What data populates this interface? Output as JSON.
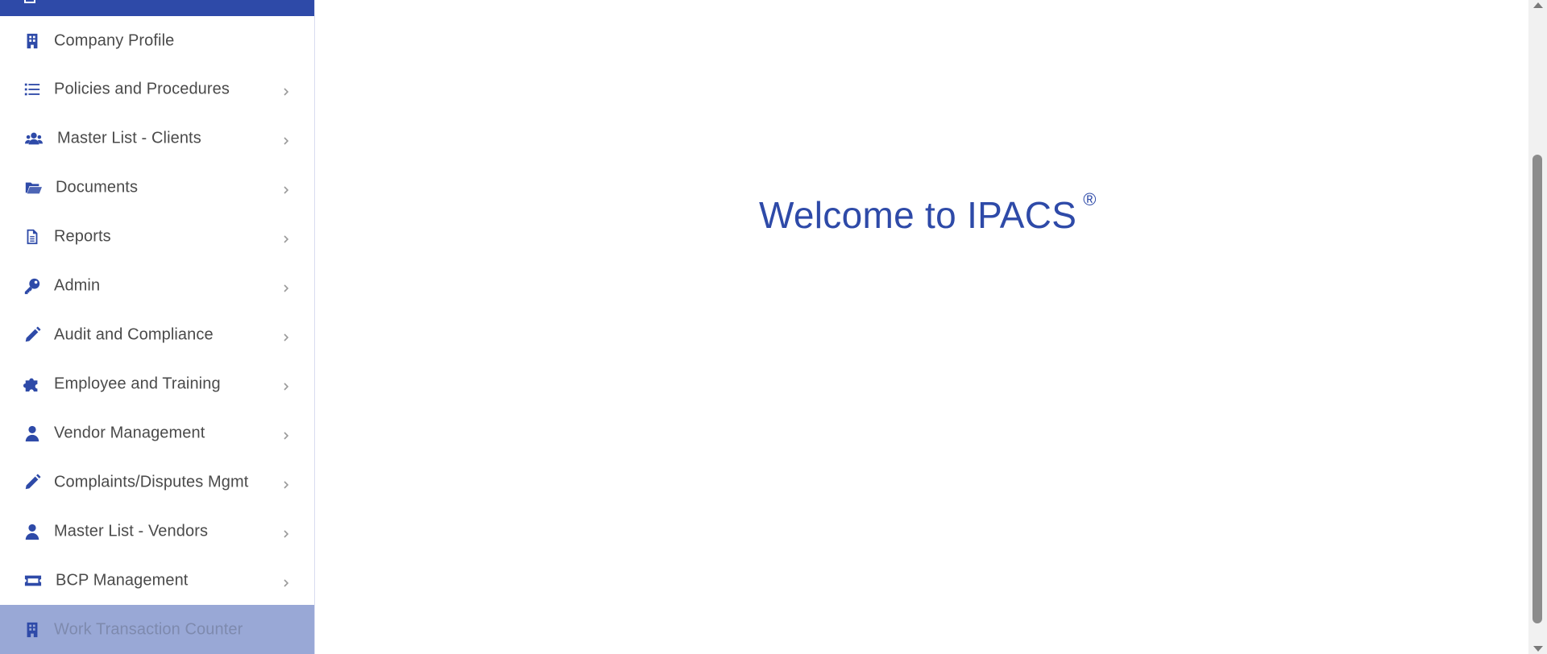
{
  "sidebar": {
    "items": [
      {
        "label": "Company Profile",
        "icon": "building-icon",
        "chevron": false
      },
      {
        "label": "Policies and Procedures",
        "icon": "list-icon",
        "chevron": true
      },
      {
        "label": "Master List - Clients",
        "icon": "users-icon",
        "chevron": true
      },
      {
        "label": "Documents",
        "icon": "folder-open-icon",
        "chevron": true
      },
      {
        "label": "Reports",
        "icon": "file-text-icon",
        "chevron": true
      },
      {
        "label": "Admin",
        "icon": "key-icon",
        "chevron": true
      },
      {
        "label": "Audit and Compliance",
        "icon": "pencil-icon",
        "chevron": true
      },
      {
        "label": "Employee and Training",
        "icon": "puzzle-icon",
        "chevron": true
      },
      {
        "label": "Vendor Management",
        "icon": "user-icon",
        "chevron": true
      },
      {
        "label": "Complaints/Disputes Mgmt",
        "icon": "pencil-icon",
        "chevron": true
      },
      {
        "label": "Master List - Vendors",
        "icon": "user-icon",
        "chevron": true
      },
      {
        "label": "BCP Management",
        "icon": "ticket-icon",
        "chevron": true
      },
      {
        "label": "Work Transaction Counter",
        "icon": "building-icon",
        "chevron": false,
        "active": true
      }
    ]
  },
  "main": {
    "welcome_text": "Welcome to IPACS",
    "registered_mark": "®"
  },
  "colors": {
    "accent": "#2e4aa8",
    "active_bg": "#99a8d6",
    "text": "#4a4a4a"
  }
}
